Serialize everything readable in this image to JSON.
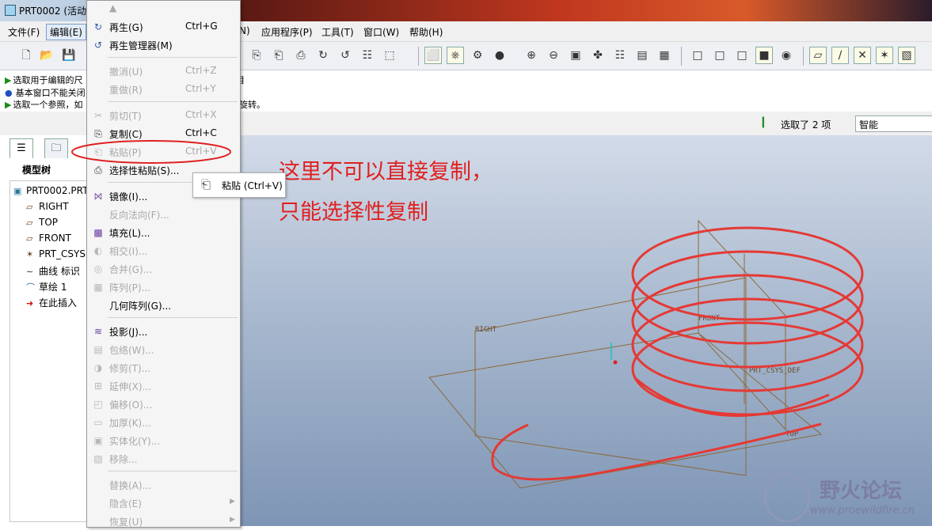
{
  "window": {
    "title": "PRT0002 (活动"
  },
  "menubar": {
    "file": "文件(F)",
    "edit": "编辑(E)",
    "partial": "N)",
    "apps": "应用程序(P)",
    "tools": "工具(T)",
    "window": "窗口(W)",
    "help": "帮助(H)"
  },
  "messages": {
    "line1": "选取用于编辑的尺",
    "line1_tail": "目",
    "line2": "基本窗口不能关闭",
    "line3": "选取一个参照，如",
    "line3_tail": "旋转。"
  },
  "status": {
    "selected": "选取了 2 项",
    "filter_value": "智能"
  },
  "left_panel": {
    "tree_title": "模型树",
    "items": [
      {
        "label": "PRT0002.PRT",
        "icon": "part-icon"
      },
      {
        "label": "RIGHT",
        "icon": "datum-plane-icon"
      },
      {
        "label": "TOP",
        "icon": "datum-plane-icon"
      },
      {
        "label": "FRONT",
        "icon": "datum-plane-icon"
      },
      {
        "label": "PRT_CSYS",
        "icon": "csys-icon"
      },
      {
        "label": "曲线 标识",
        "icon": "curve-icon"
      },
      {
        "label": "草绘 1",
        "icon": "sketch-icon"
      },
      {
        "label": "在此插入",
        "icon": "insert-arrow-icon"
      }
    ]
  },
  "edit_menu": {
    "regenerate": {
      "label": "再生(G)",
      "shortcut": "Ctrl+G"
    },
    "regen_manager": {
      "label": "再生管理器(M)"
    },
    "undo": {
      "label": "撤消(U)",
      "shortcut": "Ctrl+Z"
    },
    "redo": {
      "label": "重做(R)",
      "shortcut": "Ctrl+Y"
    },
    "cut": {
      "label": "剪切(T)",
      "shortcut": "Ctrl+X"
    },
    "copy": {
      "label": "复制(C)",
      "shortcut": "Ctrl+C"
    },
    "paste": {
      "label": "粘贴(P)",
      "shortcut": "Ctrl+V"
    },
    "paste_special": {
      "label": "选择性粘贴(S)..."
    },
    "mirror": {
      "label": "镜像(I)..."
    },
    "reverse_normal": {
      "label": "反向法向(F)..."
    },
    "fill": {
      "label": "填充(L)..."
    },
    "intersect": {
      "label": "相交(I)..."
    },
    "merge": {
      "label": "合并(G)..."
    },
    "pattern": {
      "label": "阵列(P)..."
    },
    "geom_pattern": {
      "label": "几何阵列(G)..."
    },
    "project": {
      "label": "投影(J)..."
    },
    "wrap": {
      "label": "包络(W)..."
    },
    "trim": {
      "label": "修剪(T)..."
    },
    "extend": {
      "label": "延伸(X)..."
    },
    "offset": {
      "label": "偏移(O)..."
    },
    "thicken": {
      "label": "加厚(K)..."
    },
    "solidify": {
      "label": "实体化(Y)..."
    },
    "remove": {
      "label": "移除..."
    },
    "replace": {
      "label": "替换(A)..."
    },
    "hide": {
      "label": "隐含(E)"
    },
    "resume": {
      "label": "恢复(U)"
    }
  },
  "tooltip": {
    "text": "粘贴 (Ctrl+V)"
  },
  "annotation": {
    "line1": "这里不可以直接复制，",
    "line2": "只能选择性复制"
  },
  "model_labels": {
    "right": "RIGHT",
    "front": "FRONT",
    "top": "TOP",
    "csys": "PRT_CSYS_DEF"
  },
  "watermark": {
    "title": "野火论坛",
    "url": "www.proewildfire.cn"
  },
  "colors": {
    "annotation": "#e02020",
    "spring": "#e53935",
    "datum": "#8a6a3a"
  }
}
